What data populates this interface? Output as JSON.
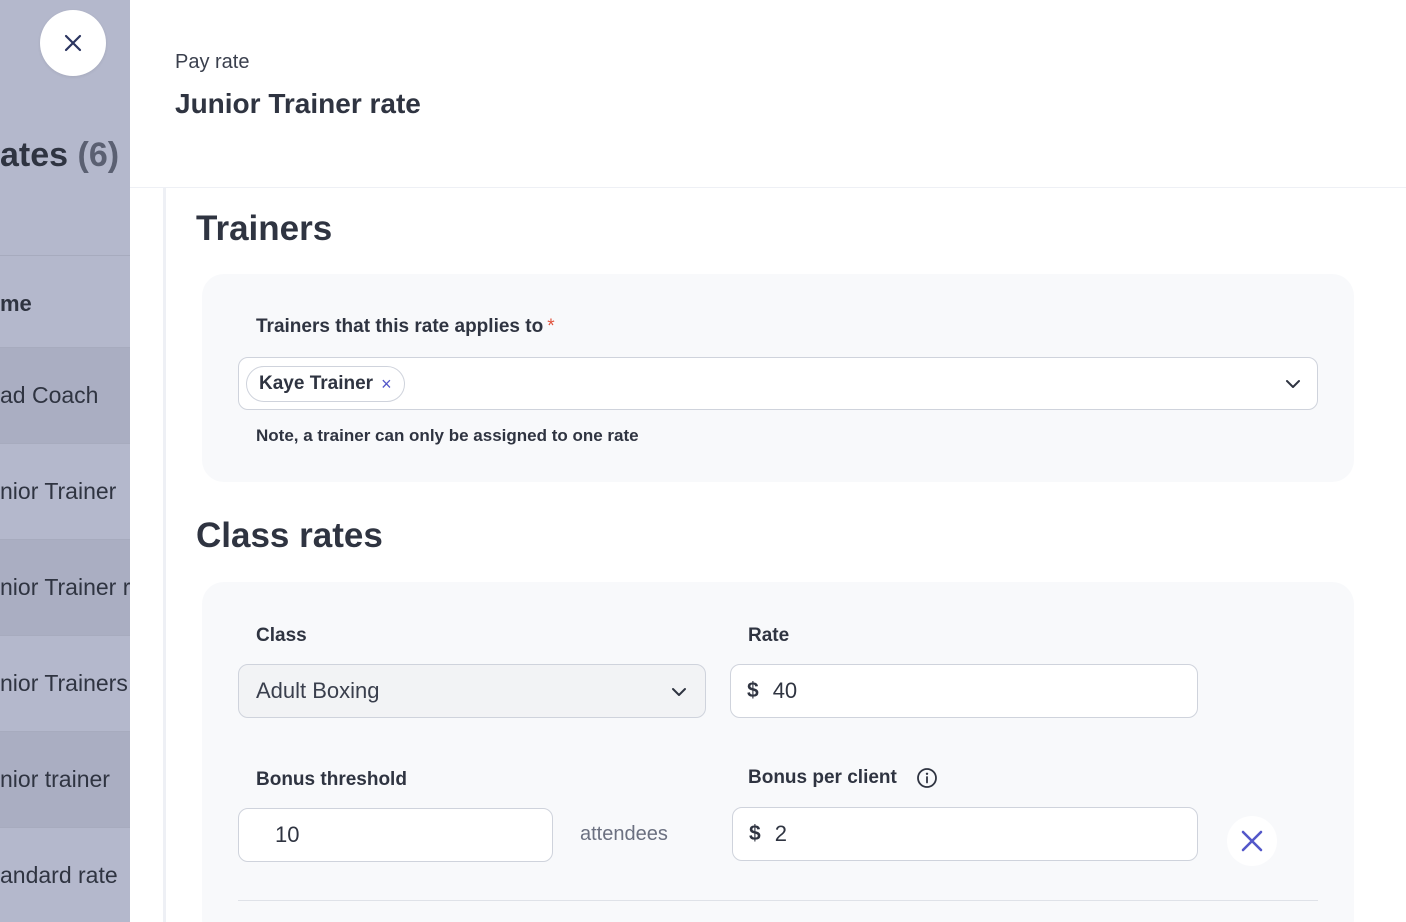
{
  "background": {
    "title": "ates",
    "count": "(6)",
    "column_header": "me",
    "rows": [
      "ad Coach",
      "nior Trainer",
      "nior Trainer r",
      "nior Trainers",
      "nior trainer",
      "andard rate"
    ]
  },
  "drawer": {
    "eyebrow": "Pay rate",
    "title": "Junior Trainer rate"
  },
  "trainers": {
    "section_title": "Trainers",
    "field_label": "Trainers that this rate applies to",
    "required_mark": "*",
    "selected": [
      "Kaye Trainer"
    ],
    "chip_remove_glyph": "×",
    "note": "Note, a trainer can only be assigned to one rate"
  },
  "class_rates": {
    "section_title": "Class rates",
    "class_label": "Class",
    "class_value": "Adult Boxing",
    "rate_label": "Rate",
    "currency": "$",
    "rate_value": "40",
    "bonus_threshold_label": "Bonus threshold",
    "bonus_threshold_value": "10",
    "bonus_threshold_suffix": "attendees",
    "bonus_per_client_label": "Bonus per client",
    "bonus_per_client_value": "2"
  },
  "colors": {
    "accent": "#5357c9",
    "required": "#e0533d",
    "overlay": "#b4b8cc",
    "card": "#f8f9fb",
    "text": "#2f3441"
  }
}
